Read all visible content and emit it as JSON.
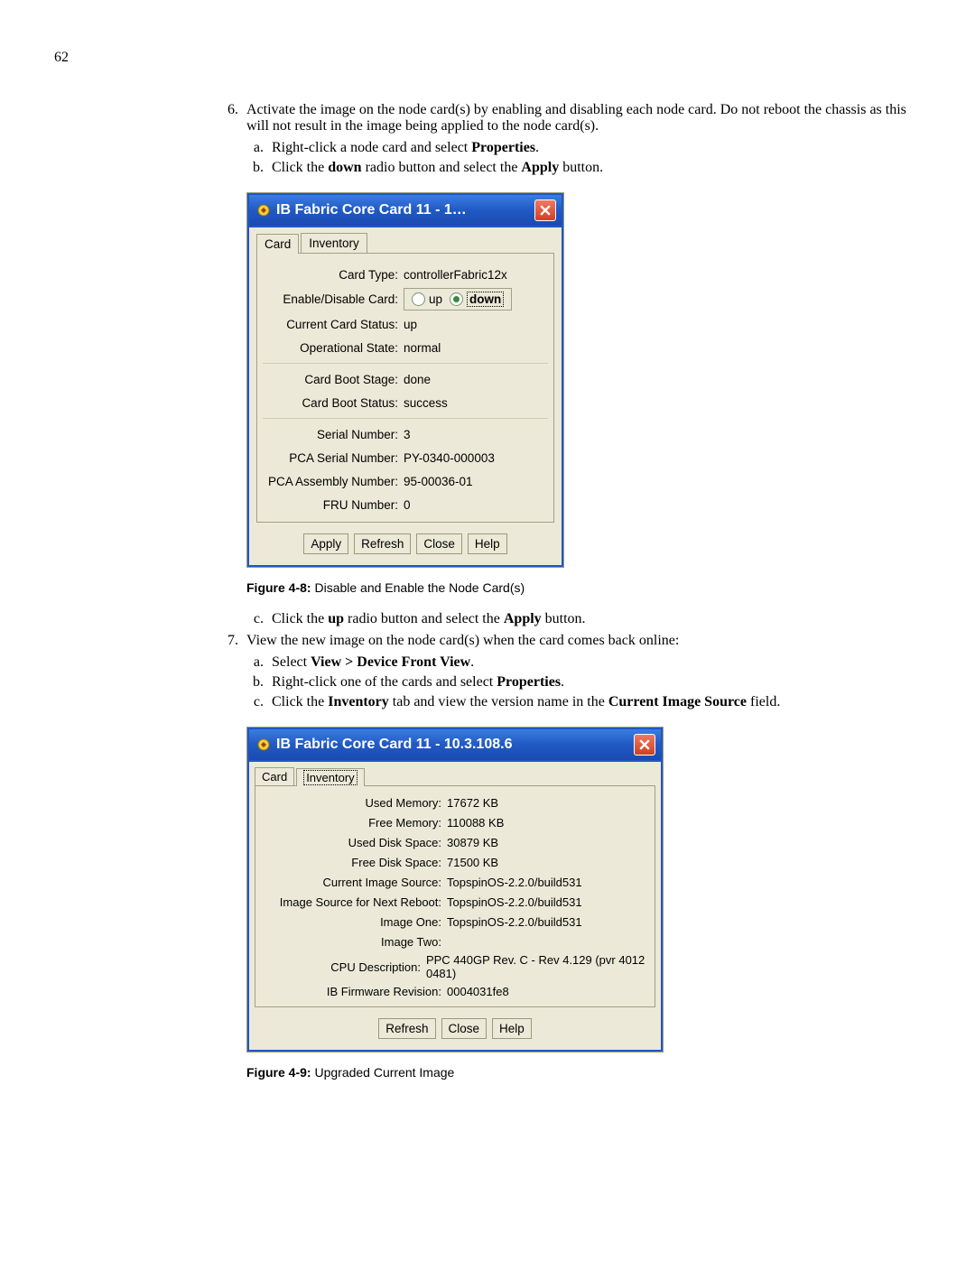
{
  "pageNumber": "62",
  "step6": {
    "num": "6.",
    "text_a": "Activate the image on the node card(s) by enabling and disabling each node card. Do not reboot the chassis as this will not result in the image being applied to the node card(s).",
    "a": {
      "pre": "Right-click a node card and select ",
      "b": "Properties",
      "post": "."
    },
    "b": {
      "t1": "Click the ",
      "b1": "down",
      "t2": " radio button and select the ",
      "b2": "Apply",
      "t3": " button."
    },
    "c": {
      "t1": "Click the ",
      "b1": "up",
      "t2": " radio button and select the ",
      "b2": "Apply",
      "t3": " button."
    }
  },
  "step7": {
    "text": "View the new image on the node card(s) when the card comes back online:",
    "a": {
      "t1": "Select ",
      "b1": "View > Device Front View",
      "t2": "."
    },
    "b": {
      "t1": "Right-click one of the cards and select ",
      "b1": "Properties",
      "t2": "."
    },
    "c": {
      "t1": "Click the ",
      "b1": "Inventory",
      "t2": " tab and view the version name in the ",
      "b2": "Current Image Source",
      "t3": " field."
    }
  },
  "fig8": {
    "label": "Figure 4-8:",
    "caption": " Disable and Enable the Node Card(s)"
  },
  "fig9": {
    "label": "Figure 4-9:",
    "caption": " Upgraded Current Image"
  },
  "dlg1": {
    "title": "IB Fabric Core Card 11 - 1…",
    "tabs": {
      "card": "Card",
      "inventory": "Inventory"
    },
    "cardType": {
      "lbl": "Card Type:",
      "val": "controllerFabric12x"
    },
    "enable": {
      "lbl": "Enable/Disable Card:",
      "up": "up",
      "down": "down"
    },
    "status": {
      "lbl": "Current Card Status:",
      "val": "up"
    },
    "opState": {
      "lbl": "Operational State:",
      "val": "normal"
    },
    "bootStage": {
      "lbl": "Card Boot Stage:",
      "val": "done"
    },
    "bootStatus": {
      "lbl": "Card Boot Status:",
      "val": "success"
    },
    "serial": {
      "lbl": "Serial Number:",
      "val": "3"
    },
    "pcaSerial": {
      "lbl": "PCA Serial Number:",
      "val": "PY-0340-000003"
    },
    "pcaAssembly": {
      "lbl": "PCA Assembly Number:",
      "val": "95-00036-01"
    },
    "fru": {
      "lbl": "FRU Number:",
      "val": "0"
    },
    "buttons": {
      "apply": "Apply",
      "refresh": "Refresh",
      "close": "Close",
      "help": "Help"
    }
  },
  "dlg2": {
    "title": "IB Fabric Core Card 11 - 10.3.108.6",
    "tabs": {
      "card": "Card",
      "inventory": "Inventory"
    },
    "usedMem": {
      "lbl": "Used Memory:",
      "val": "17672 KB"
    },
    "freeMem": {
      "lbl": "Free Memory:",
      "val": "110088 KB"
    },
    "usedDisk": {
      "lbl": "Used Disk Space:",
      "val": "30879 KB"
    },
    "freeDisk": {
      "lbl": "Free Disk Space:",
      "val": "71500 KB"
    },
    "curImg": {
      "lbl": "Current Image Source:",
      "val": "TopspinOS-2.2.0/build531"
    },
    "nextImg": {
      "lbl": "Image Source for Next Reboot:",
      "val": "TopspinOS-2.2.0/build531"
    },
    "img1": {
      "lbl": "Image One:",
      "val": "TopspinOS-2.2.0/build531"
    },
    "img2": {
      "lbl": "Image Two:",
      "val": ""
    },
    "cpu": {
      "lbl": "CPU Description:",
      "val": "PPC 440GP Rev. C - Rev 4.129 (pvr 4012 0481)"
    },
    "ibfw": {
      "lbl": "IB Firmware Revision:",
      "val": "0004031fe8"
    },
    "buttons": {
      "refresh": "Refresh",
      "close": "Close",
      "help": "Help"
    }
  }
}
